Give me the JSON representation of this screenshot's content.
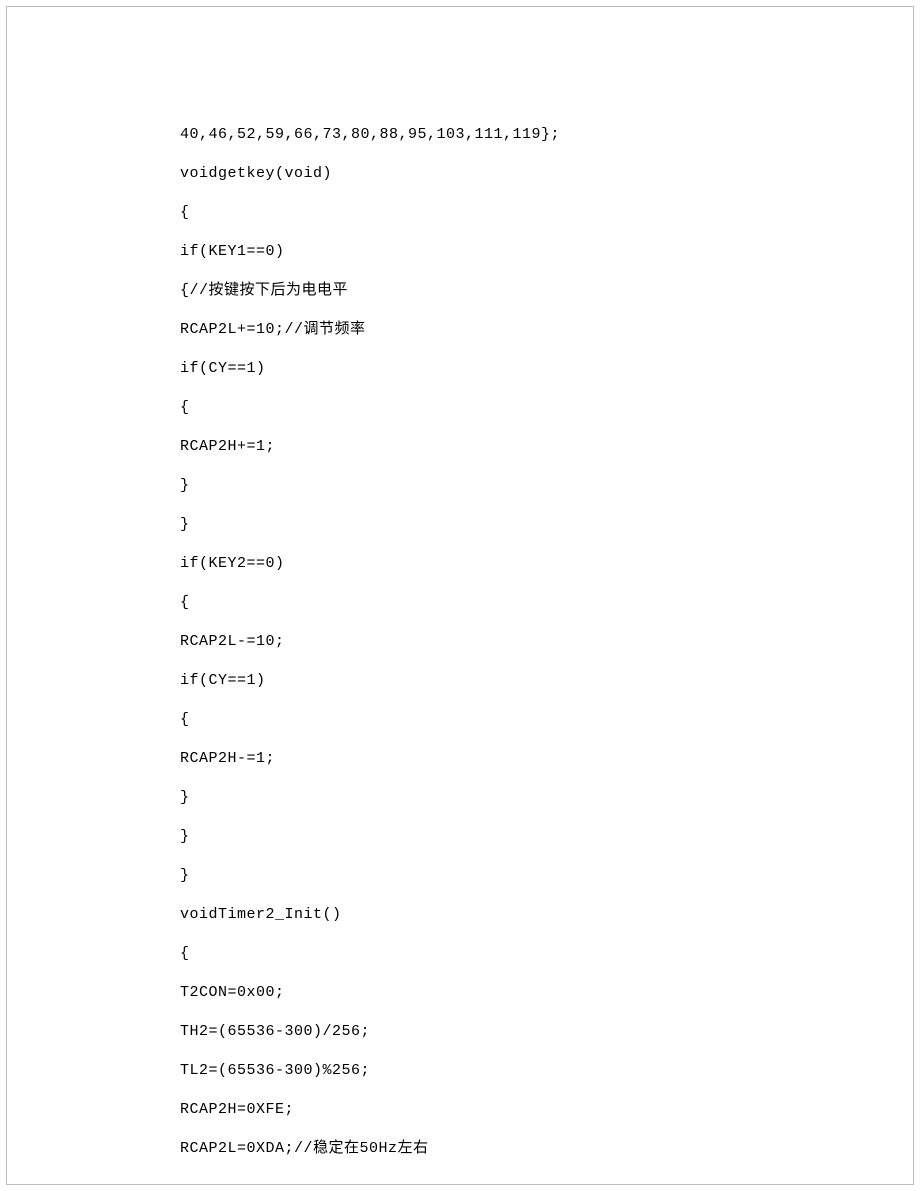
{
  "code": {
    "lines": [
      "40,46,52,59,66,73,80,88,95,103,111,119};",
      "voidgetkey(void)",
      "{",
      "if(KEY1==0)",
      "{//按键按下后为电电平",
      "RCAP2L+=10;//调节频率",
      "if(CY==1)",
      "{",
      "RCAP2H+=1;",
      "}",
      "}",
      "if(KEY2==0)",
      "{",
      "RCAP2L-=10;",
      "if(CY==1)",
      "{",
      "RCAP2H-=1;",
      "}",
      "}",
      "}",
      "voidTimer2_Init()",
      "{",
      "T2CON=0x00;",
      "TH2=(65536-300)/256;",
      "TL2=(65536-300)%256;",
      "RCAP2H=0XFE;",
      "RCAP2L=0XDA;//稳定在50Hz左右"
    ]
  }
}
